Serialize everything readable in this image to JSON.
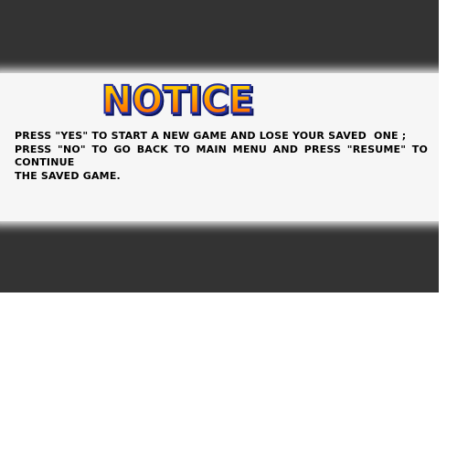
{
  "notice": {
    "title": "NOTICE",
    "lines": [
      "PRESS \"YES\" TO START A NEW GAME AND LOSE YOUR SAVED  ONE ;",
      "PRESS \"NO\" TO GO BACK TO MAIN MENU AND PRESS \"RESUME\" TO CONTINUE",
      "THE SAVED GAME."
    ]
  },
  "colors": {
    "backdrop": "#333333",
    "band": "#f6f6f6",
    "title_fill_top": "#ffe600",
    "title_fill_bottom": "#ff3c00",
    "title_outline": "#1f2fa8",
    "text": "#000000"
  }
}
